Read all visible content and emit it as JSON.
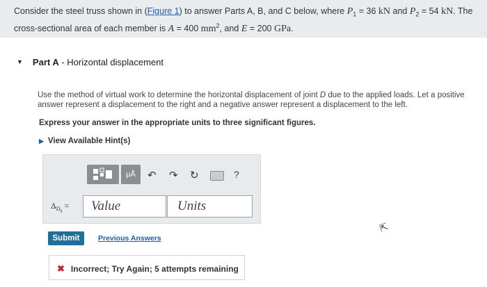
{
  "problem": {
    "t1": "Consider the steel truss shown in (",
    "figure_link": "Figure 1",
    "t2": ") to answer Parts A, B, and C below, where ",
    "p1_sym": "P",
    "p1_sub": "1",
    "p1_val": " = 36 ",
    "p1_unit": "kN",
    "t3": " and ",
    "p2_sym": "P",
    "p2_sub": "2",
    "p2_val": " = 54 ",
    "p2_unit": "kN",
    "t4": ". The",
    "t5": "cross-sectional area of each member is ",
    "a_sym": "A",
    "a_val": " = 400 ",
    "a_unit": "mm",
    "a_exp": "2",
    "t6": ", and ",
    "e_sym": "E",
    "e_val": " = 200 ",
    "e_unit": "GPa",
    "t7": "."
  },
  "part": {
    "label": "Part A",
    "title": " - Horizontal displacement"
  },
  "instructions": {
    "text1": "Use the method of virtual work to determine the horizontal displacement of joint ",
    "joint": "D",
    "text2": " due to the applied loads. Let a positive answer represent a displacement to the right and a negative answer represent a displacement to the left.",
    "express": "Express your answer in the appropriate units to three significant figures."
  },
  "hints": {
    "label": "View Available Hint(s)"
  },
  "toolbar": {
    "templates_icon": "templates-icon",
    "units_label": "μÅ",
    "undo_icon": "undo-icon",
    "redo_icon": "redo-icon",
    "reset_icon": "reset-icon",
    "keyboard_icon": "keyboard-icon",
    "help_label": "?"
  },
  "answer": {
    "label_delta": "Δ",
    "label_sub": "D",
    "label_subsub": "h",
    "label_eq": " =",
    "value_placeholder": "Value",
    "units_placeholder": "Units"
  },
  "actions": {
    "submit_label": "Submit",
    "previous_answers": "Previous Answers"
  },
  "feedback": {
    "icon": "x-icon",
    "text": "Incorrect; Try Again; 5 attempts remaining"
  },
  "colors": {
    "accent": "#1f5fa8",
    "submit": "#1f6f9a",
    "error": "#c0282d"
  }
}
